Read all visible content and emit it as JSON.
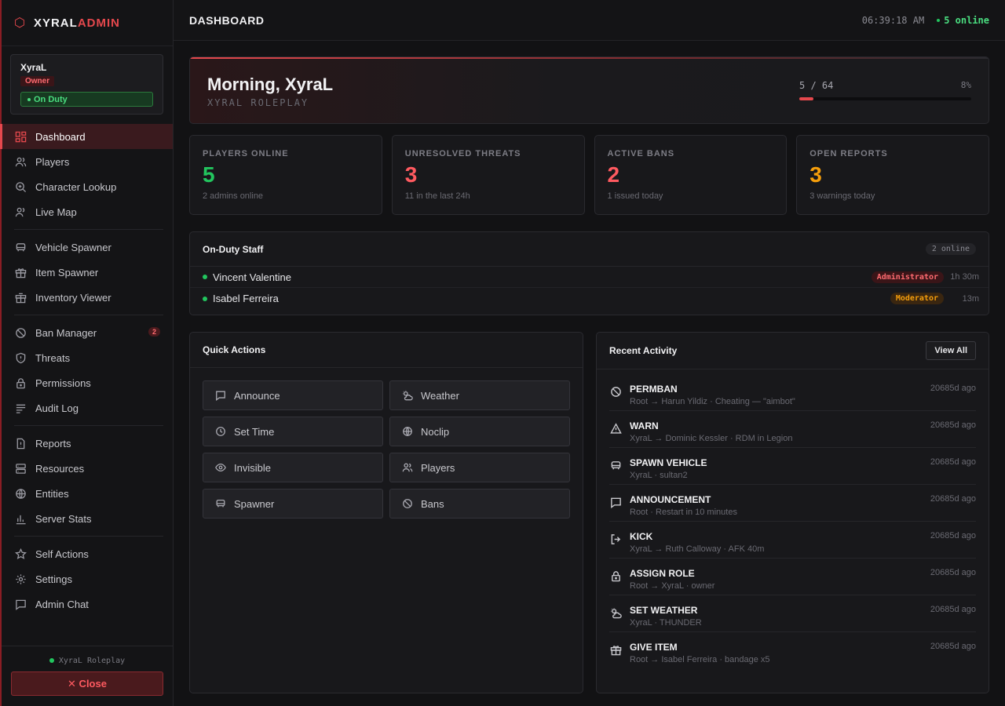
{
  "brand": {
    "part1": "XYRAL",
    "part2": "ADMIN",
    "icon": "hexagon-icon"
  },
  "user": {
    "name": "XyraL",
    "role": "Owner",
    "status": "On Duty"
  },
  "nav": {
    "dashboard": "Dashboard",
    "players": "Players",
    "character_lookup": "Character Lookup",
    "live_map": "Live Map",
    "vehicle_spawner": "Vehicle Spawner",
    "item_spawner": "Item Spawner",
    "inventory_viewer": "Inventory Viewer",
    "ban_manager": "Ban Manager",
    "ban_manager_count": "2",
    "threats": "Threats",
    "permissions": "Permissions",
    "audit_log": "Audit Log",
    "reports": "Reports",
    "resources": "Resources",
    "entities": "Entities",
    "server_stats": "Server Stats",
    "self_actions": "Self Actions",
    "settings": "Settings",
    "admin_chat": "Admin Chat"
  },
  "footer": {
    "server": "XyraL Roleplay",
    "close_label": "✕ Close"
  },
  "topbar": {
    "title": "DASHBOARD",
    "clock": "06:39:18 AM",
    "online": "5 online"
  },
  "hero": {
    "greeting": "Morning, XyraL",
    "server_name": "XYRAL ROLEPLAY",
    "capacity_text": "5 / 64",
    "capacity_percent": "8%",
    "capacity_fraction": 0.08
  },
  "stats": [
    {
      "label": "PLAYERS ONLINE",
      "value": "5",
      "sub": "2 admins online",
      "color": "#22c55e"
    },
    {
      "label": "UNRESOLVED THREATS",
      "value": "3",
      "sub": "11 in the last 24h",
      "color": "#ff5a60"
    },
    {
      "label": "ACTIVE BANS",
      "value": "2",
      "sub": "1 issued today",
      "color": "#ff5a60"
    },
    {
      "label": "OPEN REPORTS",
      "value": "3",
      "sub": "3 warnings today",
      "color": "#f59e0b"
    }
  ],
  "staff": {
    "title": "On-Duty Staff",
    "count": "2 online",
    "members": [
      {
        "name": "Vincent Valentine",
        "role": "Administrator",
        "time": "1h 30m"
      },
      {
        "name": "Isabel Ferreira",
        "role": "Moderator",
        "time": "13m"
      }
    ]
  },
  "quick_actions": {
    "title": "Quick Actions",
    "buttons": [
      "Announce",
      "Weather",
      "Set Time",
      "Noclip",
      "Invisible",
      "Players",
      "Spawner",
      "Bans"
    ]
  },
  "recent_activity": {
    "title": "Recent Activity",
    "view_all": "View All",
    "items": [
      {
        "title": "PERMBAN",
        "detail": "Root → Harun Yildiz · Cheating — \"aimbot\"",
        "time": "20685d ago",
        "icon": "ban-icon"
      },
      {
        "title": "WARN",
        "detail": "XyraL → Dominic Kessler · RDM in Legion",
        "time": "20685d ago",
        "icon": "warning-icon"
      },
      {
        "title": "SPAWN VEHICLE",
        "detail": "XyraL · sultan2",
        "time": "20685d ago",
        "icon": "car-icon"
      },
      {
        "title": "ANNOUNCEMENT",
        "detail": "Root · Restart in 10 minutes",
        "time": "20685d ago",
        "icon": "message-icon"
      },
      {
        "title": "KICK",
        "detail": "XyraL → Ruth Calloway · AFK 40m",
        "time": "20685d ago",
        "icon": "logout-icon"
      },
      {
        "title": "ASSIGN ROLE",
        "detail": "Root → XyraL · owner",
        "time": "20685d ago",
        "icon": "lock-icon"
      },
      {
        "title": "SET WEATHER",
        "detail": "XyraL · THUNDER",
        "time": "20685d ago",
        "icon": "weather-icon"
      },
      {
        "title": "GIVE ITEM",
        "detail": "Root → Isabel Ferreira · bandage x5",
        "time": "20685d ago",
        "icon": "gift-icon"
      }
    ]
  }
}
